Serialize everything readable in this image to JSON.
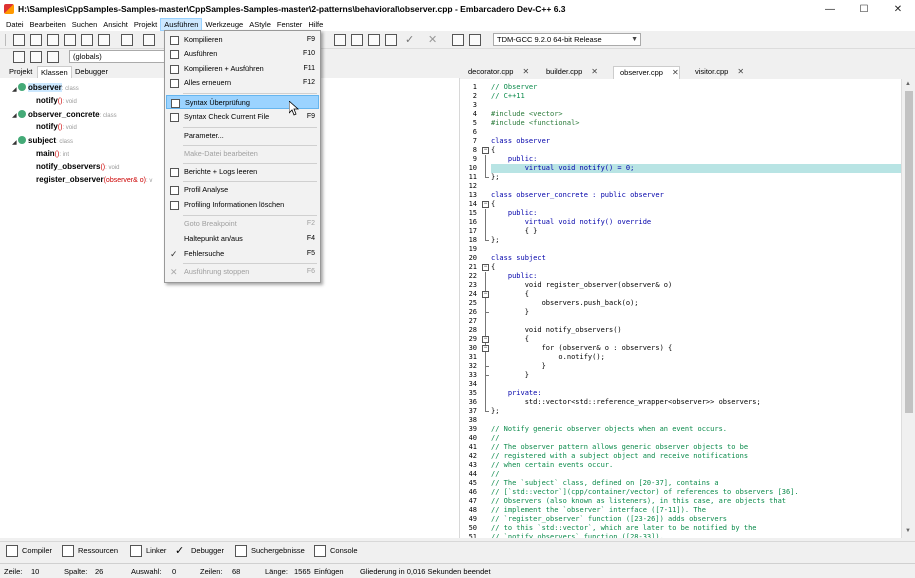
{
  "window": {
    "title": "H:\\Samples\\CppSamples-Samples-master\\CppSamples-Samples-master\\2-patterns\\behavioral\\observer.cpp - Embarcadero Dev-C++ 6.3",
    "minimize": "—",
    "maximize": "☐",
    "close": "✕"
  },
  "menubar": [
    "Datei",
    "Bearbeiten",
    "Suchen",
    "Ansicht",
    "Projekt",
    "Ausführen",
    "Werkzeuge",
    "AStyle",
    "Fenster",
    "Hilfe"
  ],
  "toolbar": {
    "compiler_select": "TDM-GCC 9.2.0 64-bit Release",
    "scope_select": "(globals)"
  },
  "run_menu": {
    "items": [
      {
        "label": "Kompilieren",
        "shortcut": "F9",
        "icon": "grid-icon",
        "enabled": true
      },
      {
        "label": "Ausführen",
        "shortcut": "F10",
        "icon": "grid-icon",
        "enabled": true
      },
      {
        "label": "Kompilieren + Ausführen",
        "shortcut": "F11",
        "icon": "grid-icon",
        "enabled": true
      },
      {
        "label": "Alles erneuern",
        "shortcut": "F12",
        "icon": "grid-icon",
        "enabled": true
      },
      {
        "label": "Syntax Überprüfung",
        "shortcut": "",
        "icon": "check-doc-icon",
        "enabled": true,
        "highlighted": true
      },
      {
        "label": "Syntax Check Current File",
        "shortcut": "F9",
        "icon": "check-doc-icon",
        "enabled": true
      },
      {
        "label": "Parameter...",
        "shortcut": "",
        "icon": "",
        "enabled": true
      },
      {
        "label": "Make-Datei bearbeiten",
        "shortcut": "",
        "icon": "",
        "enabled": false
      },
      {
        "label": "Berichte + Logs leeren",
        "shortcut": "",
        "icon": "trash-icon",
        "enabled": true
      },
      {
        "label": "Profil Analyse",
        "shortcut": "",
        "icon": "profile-icon",
        "enabled": true
      },
      {
        "label": "Profiling Informationen löschen",
        "shortcut": "",
        "icon": "delete-profile-icon",
        "enabled": true
      },
      {
        "label": "Goto Breakpoint",
        "shortcut": "F2",
        "icon": "",
        "enabled": false
      },
      {
        "label": "Haltepunkt an/aus",
        "shortcut": "F4",
        "icon": "",
        "enabled": true
      },
      {
        "label": "Fehlersuche",
        "shortcut": "F5",
        "icon": "checkmark-icon",
        "enabled": true
      },
      {
        "label": "Ausführung stoppen",
        "shortcut": "F6",
        "icon": "stop-icon",
        "enabled": false
      }
    ]
  },
  "left_panel": {
    "tabs": [
      "Projekt",
      "Klassen",
      "Debugger"
    ],
    "active_tab": "Klassen",
    "tree": [
      {
        "name": "observer",
        "type": ": class",
        "params": "",
        "level": 0,
        "selected": true
      },
      {
        "name": "notify",
        "type": ": void",
        "params": "()",
        "level": 1
      },
      {
        "name": "observer_concrete",
        "type": ": class",
        "params": "",
        "level": 0
      },
      {
        "name": "notify",
        "type": ": void",
        "params": "()",
        "level": 1
      },
      {
        "name": "subject",
        "type": ": class",
        "params": "",
        "level": 0
      },
      {
        "name": "main",
        "type": ": int",
        "params": "()",
        "level": 1
      },
      {
        "name": "notify_observers",
        "type": ": void",
        "params": "()",
        "level": 1
      },
      {
        "name": "register_observer",
        "type": ": v",
        "params": "(observer& o)",
        "level": 1
      }
    ]
  },
  "editor": {
    "tabs": [
      "decorator.cpp",
      "builder.cpp",
      "observer.cpp",
      "visitor.cpp"
    ],
    "active_tab": "observer.cpp",
    "lines": [
      {
        "n": "1",
        "t": "// Observer",
        "c": "cm"
      },
      {
        "n": "2",
        "t": "// C++11",
        "c": "cm"
      },
      {
        "n": "3",
        "t": "",
        "c": "plain"
      },
      {
        "n": "4",
        "t": "#include <vector>",
        "c": "pp"
      },
      {
        "n": "5",
        "t": "#include <functional>",
        "c": "pp"
      },
      {
        "n": "6",
        "t": "",
        "c": "plain"
      },
      {
        "n": "7",
        "t": "class observer",
        "c": "kw"
      },
      {
        "n": "8",
        "t": "{",
        "c": "plain"
      },
      {
        "n": "9",
        "t": "    public:",
        "c": "kw"
      },
      {
        "n": "10",
        "t": "        virtual void notify() = 0;",
        "c": "kw"
      },
      {
        "n": "11",
        "t": "};",
        "c": "plain"
      },
      {
        "n": "12",
        "t": "",
        "c": "plain"
      },
      {
        "n": "13",
        "t": "class observer_concrete : public observer",
        "c": "kw"
      },
      {
        "n": "14",
        "t": "{",
        "c": "plain"
      },
      {
        "n": "15",
        "t": "    public:",
        "c": "kw"
      },
      {
        "n": "16",
        "t": "        virtual void notify() override",
        "c": "kw"
      },
      {
        "n": "17",
        "t": "        { }",
        "c": "plain"
      },
      {
        "n": "18",
        "t": "};",
        "c": "plain"
      },
      {
        "n": "19",
        "t": "",
        "c": "plain"
      },
      {
        "n": "20",
        "t": "class subject",
        "c": "kw"
      },
      {
        "n": "21",
        "t": "{",
        "c": "plain"
      },
      {
        "n": "22",
        "t": "    public:",
        "c": "kw"
      },
      {
        "n": "23",
        "t": "        void register_observer(observer& o)",
        "c": "plain"
      },
      {
        "n": "24",
        "t": "        {",
        "c": "plain"
      },
      {
        "n": "25",
        "t": "            observers.push_back(o);",
        "c": "plain"
      },
      {
        "n": "26",
        "t": "        }",
        "c": "plain"
      },
      {
        "n": "27",
        "t": "",
        "c": "plain"
      },
      {
        "n": "28",
        "t": "        void notify_observers()",
        "c": "plain"
      },
      {
        "n": "29",
        "t": "        {",
        "c": "plain"
      },
      {
        "n": "30",
        "t": "            for (observer& o : observers) {",
        "c": "plain"
      },
      {
        "n": "31",
        "t": "                o.notify();",
        "c": "plain"
      },
      {
        "n": "32",
        "t": "            }",
        "c": "plain"
      },
      {
        "n": "33",
        "t": "        }",
        "c": "plain"
      },
      {
        "n": "34",
        "t": "",
        "c": "plain"
      },
      {
        "n": "35",
        "t": "    private:",
        "c": "kw"
      },
      {
        "n": "36",
        "t": "        std::vector<std::reference_wrapper<observer>> observers;",
        "c": "plain"
      },
      {
        "n": "37",
        "t": "};",
        "c": "plain"
      },
      {
        "n": "38",
        "t": "",
        "c": "plain"
      },
      {
        "n": "39",
        "t": "// Notify generic observer objects when an event occurs.",
        "c": "cm"
      },
      {
        "n": "40",
        "t": "//",
        "c": "cm"
      },
      {
        "n": "41",
        "t": "// The observer pattern allows generic observer objects to be",
        "c": "cm"
      },
      {
        "n": "42",
        "t": "// registered with a subject object and receive notifications",
        "c": "cm"
      },
      {
        "n": "43",
        "t": "// when certain events occur.",
        "c": "cm"
      },
      {
        "n": "44",
        "t": "//",
        "c": "cm"
      },
      {
        "n": "45",
        "t": "// The `subject` class, defined on [20-37], contains a",
        "c": "cm"
      },
      {
        "n": "46",
        "t": "// [`std::vector`](cpp/container/vector) of references to observers [36].",
        "c": "cm"
      },
      {
        "n": "47",
        "t": "// Observers (also known as listeners), in this case, are objects that",
        "c": "cm"
      },
      {
        "n": "48",
        "t": "// implement the `observer` interface ([7-11]). The",
        "c": "cm"
      },
      {
        "n": "49",
        "t": "// `register_observer` function ([23-26]) adds observers",
        "c": "cm"
      },
      {
        "n": "50",
        "t": "// to this `std::vector`, which are later to be notified by the",
        "c": "cm"
      },
      {
        "n": "51",
        "t": "// `notify_observers` function ([28-33]).",
        "c": "cm"
      }
    ]
  },
  "bottom_tabs": [
    "Compiler",
    "Ressourcen",
    "Linker",
    "Debugger",
    "Suchergebnisse",
    "Console"
  ],
  "statusbar": {
    "zeile_label": "Zeile:",
    "zeile": "10",
    "spalte_label": "Spalte:",
    "spalte": "26",
    "auswahl_label": "Auswahl:",
    "auswahl": "0",
    "zeilen_label": "Zeilen:",
    "zeilen": "68",
    "laenge_label": "Länge:",
    "laenge": "1565",
    "mode": "Einfügen",
    "message": "Gliederung in 0,016 Sekunden beendet"
  }
}
